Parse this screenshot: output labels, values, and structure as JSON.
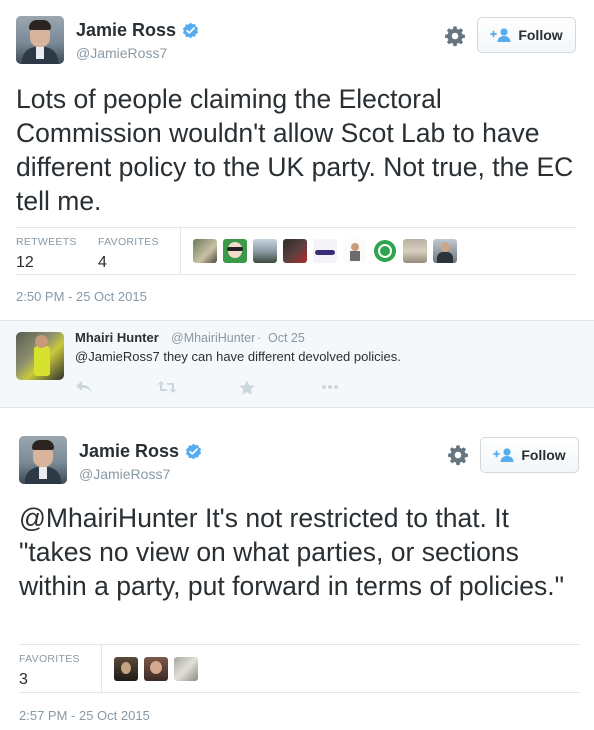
{
  "tweet1": {
    "author_name": "Jamie Ross",
    "author_handle": "@JamieRoss7",
    "follow_label": "Follow",
    "text": "Lots of people claiming the Electoral Commission wouldn't allow Scot Lab to have different policy to the UK party. Not true, the EC tell me.",
    "retweets_label": "RETWEETS",
    "retweets_count": "12",
    "favorites_label": "FAVORITES",
    "favorites_count": "4",
    "timestamp": "2:50 PM - 25 Oct 2015"
  },
  "reply": {
    "author_name": "Mhairi Hunter",
    "author_handle": "@MhairiHunter",
    "date": "Oct 25",
    "text": "@JamieRoss7 they can have different devolved policies.",
    "actions": [
      "reply-icon",
      "retweet-icon",
      "favorite-icon",
      "more-icon"
    ]
  },
  "tweet2": {
    "author_name": "Jamie Ross",
    "author_handle": "@JamieRoss7",
    "follow_label": "Follow",
    "text": "@MhairiHunter It's not restricted to that. It \"takes no view on what parties, or sections within a party, put forward in terms of policies.\"",
    "favorites_label": "FAVORITES",
    "favorites_count": "3",
    "timestamp": "2:57 PM - 25 Oct 2015"
  },
  "colors": {
    "verified": "#55acee",
    "follow_icon": "#55acee",
    "muted": "#8899a6",
    "text": "#292f33"
  }
}
